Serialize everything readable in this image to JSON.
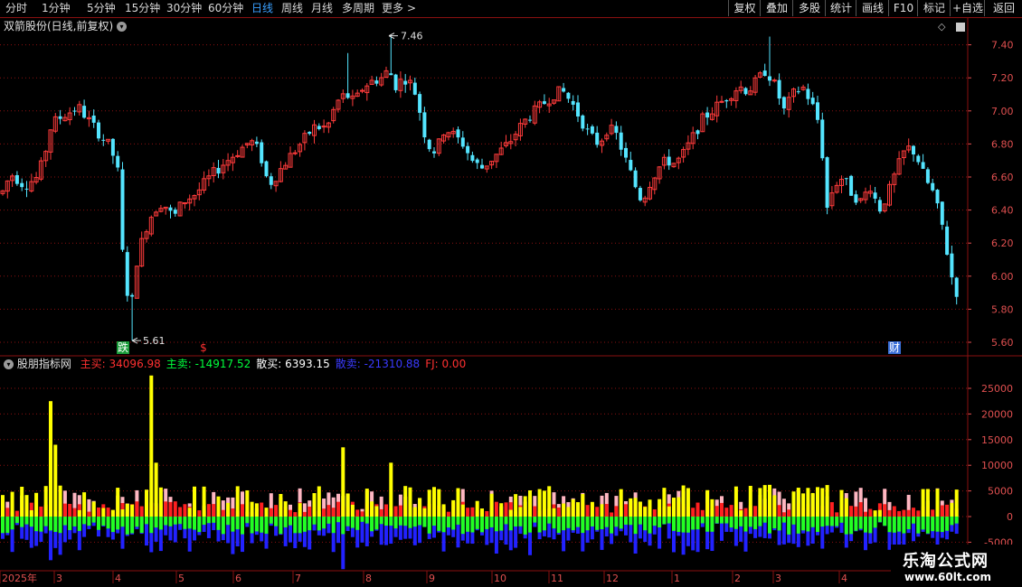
{
  "toolbar": {
    "periods": [
      "分时",
      "1分钟",
      "5分钟",
      "15分钟",
      "30分钟",
      "60分钟",
      "日线",
      "周线",
      "月线",
      "多周期",
      "更多"
    ],
    "active_period": "日线",
    "more_arrow": ">",
    "right_buttons": [
      "复权",
      "叠加",
      "多股",
      "统计",
      "画线",
      "F10",
      "标记",
      "+自选",
      "返回"
    ]
  },
  "main_panel": {
    "title": "双箭股份(日线,前复权)",
    "high_label": "7.46",
    "low_label": "5.61",
    "markers": [
      {
        "text": "跌",
        "color": "#1a9c3a"
      },
      {
        "text": "$",
        "color": "#ff3030"
      },
      {
        "text": "财",
        "color": "#3a6fd8"
      }
    ],
    "y_ticks": [
      "7.40",
      "7.20",
      "7.00",
      "6.80",
      "6.60",
      "6.40",
      "6.20",
      "6.00",
      "5.80",
      "5.60"
    ]
  },
  "indicator_panel": {
    "title": "股朋指标网",
    "fields": [
      {
        "label": "主买:",
        "value": "34096.98",
        "color": "#ff3030"
      },
      {
        "label": "主卖:",
        "value": "-14917.52",
        "color": "#00ff3c"
      },
      {
        "label": "散买:",
        "value": "6393.15",
        "color": "#ffffff"
      },
      {
        "label": "散卖:",
        "value": "-21310.88",
        "color": "#3a3aff"
      },
      {
        "label": "FJ:",
        "value": "0.00",
        "color": "#ff3030"
      }
    ],
    "y_ticks": [
      "25000",
      "20000",
      "15000",
      "10000",
      "5000",
      "0",
      "-5000"
    ]
  },
  "x_axis": {
    "labels": [
      "2025年",
      "3",
      "4",
      "5",
      "6",
      "7",
      "8",
      "9",
      "10",
      "11",
      "12",
      "1",
      "2",
      "3",
      "4"
    ]
  },
  "watermark": {
    "line1": "乐淘公式网",
    "line2": "www.60lt.com"
  },
  "colors": {
    "up": "#ff3b3b",
    "down": "#54e5ff",
    "grid": "#8a1010",
    "axis_text": "#e05050",
    "vol_up": "#ffff00",
    "vol_red": "#ff2020",
    "vol_pink": "#ffb6c1",
    "vol_green": "#22ff22",
    "vol_blue": "#2222ff",
    "active_tab": "#3aa0ff"
  },
  "chart_data": {
    "type": "candlestick",
    "title": "双箭股份(日线,前复权)",
    "ylim": [
      5.5,
      7.6
    ],
    "high": 7.46,
    "low": 5.61,
    "path_x": [
      0,
      10,
      25,
      40,
      48,
      55,
      70,
      85,
      95,
      105,
      120,
      128,
      135,
      143,
      150,
      160,
      168,
      178,
      190,
      200,
      215,
      230,
      245,
      260,
      275,
      285,
      295,
      305,
      315,
      330,
      345,
      360,
      370,
      380,
      390,
      400,
      410,
      420,
      428,
      435,
      445,
      455,
      462,
      470,
      480,
      490,
      500,
      510,
      520,
      530,
      540,
      550,
      560,
      570,
      580,
      590,
      600,
      610,
      620,
      630,
      640,
      650,
      660,
      670,
      680,
      690,
      700,
      708,
      715,
      725,
      735,
      745,
      755,
      765,
      775,
      785,
      795,
      805,
      815,
      825,
      835,
      845,
      855,
      865,
      875,
      885,
      895,
      905,
      912,
      920,
      930,
      940,
      950,
      960,
      970,
      980,
      990,
      1000,
      1010,
      1020,
      1030,
      1040,
      1050,
      1062
    ],
    "path_y": [
      6.5,
      6.62,
      6.55,
      6.6,
      6.75,
      6.92,
      6.98,
      7.02,
      6.95,
      6.88,
      6.78,
      6.65,
      6.0,
      5.8,
      6.12,
      6.3,
      6.4,
      6.45,
      6.35,
      6.45,
      6.5,
      6.6,
      6.68,
      6.75,
      6.82,
      6.75,
      6.55,
      6.62,
      6.7,
      6.8,
      6.9,
      6.9,
      7.05,
      7.1,
      7.05,
      7.15,
      7.18,
      7.2,
      7.25,
      7.15,
      7.2,
      7.15,
      7.0,
      6.8,
      6.75,
      6.9,
      6.85,
      6.8,
      6.7,
      6.65,
      6.7,
      6.75,
      6.8,
      6.88,
      6.95,
      7.0,
      7.05,
      7.1,
      7.12,
      7.05,
      6.95,
      6.85,
      6.8,
      6.9,
      6.85,
      6.7,
      6.55,
      6.45,
      6.55,
      6.65,
      6.7,
      6.68,
      6.75,
      6.85,
      6.95,
      7.0,
      7.05,
      7.1,
      7.15,
      7.12,
      7.18,
      7.25,
      7.15,
      7.0,
      7.1,
      7.15,
      7.05,
      6.9,
      6.4,
      6.55,
      6.6,
      6.5,
      6.45,
      6.55,
      6.4,
      6.5,
      6.65,
      6.78,
      6.75,
      6.6,
      6.5,
      6.3,
      6.0,
      5.8
    ],
    "extreme_candles": [
      {
        "x": 145,
        "low": 5.61
      },
      {
        "x": 430,
        "high": 7.46
      },
      {
        "x": 848,
        "high": 7.45
      },
      {
        "x": 380,
        "high": 7.35
      }
    ],
    "volume": {
      "ylim": [
        -9500,
        28000
      ],
      "spikes": [
        {
          "x": 55,
          "value": 22500
        },
        {
          "x": 59,
          "value": 14000
        },
        {
          "x": 167,
          "value": 27500
        },
        {
          "x": 171,
          "value": 10500
        },
        {
          "x": 380,
          "value": 13500
        },
        {
          "x": 430,
          "value": 10500
        }
      ]
    }
  }
}
